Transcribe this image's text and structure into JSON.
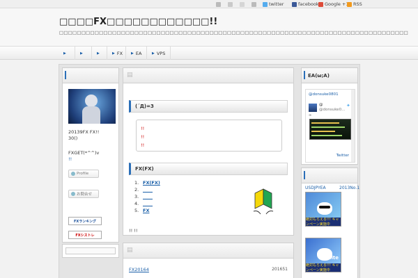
{
  "topbar": {
    "twitter": "twitter",
    "facebook": "facebook",
    "google": "Google +1",
    "rss": "RSS"
  },
  "header": {
    "title": "□□□□FX□□□□□□□□□□□□!!",
    "description": "□□□□□□□□□□□□□□□□□□□□□□□□□□□□□□□□□□□□□□□□□□□□□□□□□□□□□□□□□□□□□□□□□□□□□□□□□□□□□□□"
  },
  "nav": {
    "items": [
      "",
      "",
      "",
      "FX",
      "EA",
      "VPS"
    ]
  },
  "left": {
    "profile_text_1": "20139FX FX!!",
    "profile_text_2": "30()",
    "profile_text_3": "FXGET(*^^)v",
    "profile_link": "!!",
    "profile_button": "Profile",
    "contact_button": "お問合せ",
    "banner_1": "FXランキング",
    "banner_2": "FXシストレ"
  },
  "main": {
    "section1_title": "(´Д)=3",
    "quote_lines": [
      "!!",
      "!!",
      "!!"
    ],
    "section2_title": "FX(FX)",
    "list_items": [
      "FX(FX)",
      "",
      "",
      "",
      "FX"
    ],
    "note": "!!                                    !!",
    "post_title": "FX20164",
    "post_date": "201651"
  },
  "right": {
    "head_title": "EA(ω;A)",
    "twitter_handle": "@donsuke0801",
    "tweet_user": "@",
    "tweet_handle": "@donsuke0...",
    "tweet_more": "∞",
    "twitter_link": "Twitter",
    "link_text": "USDJPYEA",
    "rank_text": "2013No.1",
    "ad_text": "絶対もらえる!!! キャンペーン実施中",
    "ad2_label": "White"
  },
  "colors": {
    "accent": "#2b6fb8",
    "link": "#1a5fa8",
    "alert": "#cc0000"
  }
}
